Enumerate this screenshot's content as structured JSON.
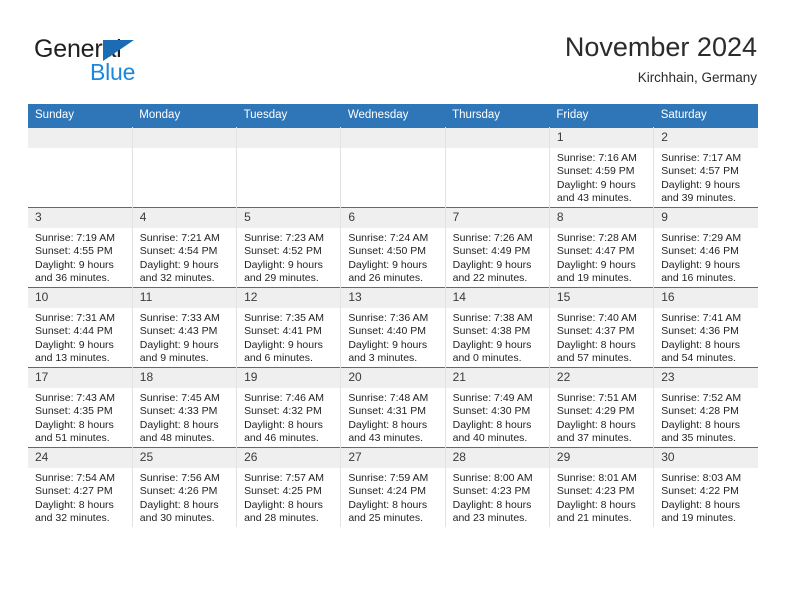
{
  "brand": {
    "name_part1": "General",
    "name_part2": "Blue",
    "triangle_color": "#1b6cb3",
    "blue_text_color": "#1b87dd"
  },
  "header": {
    "title": "November 2024",
    "subtitle": "Kirchhain, Germany"
  },
  "theme": {
    "header_blue": "#2f76b8",
    "daynum_band": "#efefef",
    "cell_border": "#e2e2e2",
    "text": "#231f20"
  },
  "calendar": {
    "weekday_headers": [
      "Sunday",
      "Monday",
      "Tuesday",
      "Wednesday",
      "Thursday",
      "Friday",
      "Saturday"
    ],
    "weeks": [
      [
        {
          "day": "",
          "lines": [
            "",
            "",
            "",
            ""
          ]
        },
        {
          "day": "",
          "lines": [
            "",
            "",
            "",
            ""
          ]
        },
        {
          "day": "",
          "lines": [
            "",
            "",
            "",
            ""
          ]
        },
        {
          "day": "",
          "lines": [
            "",
            "",
            "",
            ""
          ]
        },
        {
          "day": "",
          "lines": [
            "",
            "",
            "",
            ""
          ]
        },
        {
          "day": "1",
          "lines": [
            "Sunrise: 7:16 AM",
            "Sunset: 4:59 PM",
            "Daylight: 9 hours",
            "and 43 minutes."
          ]
        },
        {
          "day": "2",
          "lines": [
            "Sunrise: 7:17 AM",
            "Sunset: 4:57 PM",
            "Daylight: 9 hours",
            "and 39 minutes."
          ]
        }
      ],
      [
        {
          "day": "3",
          "lines": [
            "Sunrise: 7:19 AM",
            "Sunset: 4:55 PM",
            "Daylight: 9 hours",
            "and 36 minutes."
          ]
        },
        {
          "day": "4",
          "lines": [
            "Sunrise: 7:21 AM",
            "Sunset: 4:54 PM",
            "Daylight: 9 hours",
            "and 32 minutes."
          ]
        },
        {
          "day": "5",
          "lines": [
            "Sunrise: 7:23 AM",
            "Sunset: 4:52 PM",
            "Daylight: 9 hours",
            "and 29 minutes."
          ]
        },
        {
          "day": "6",
          "lines": [
            "Sunrise: 7:24 AM",
            "Sunset: 4:50 PM",
            "Daylight: 9 hours",
            "and 26 minutes."
          ]
        },
        {
          "day": "7",
          "lines": [
            "Sunrise: 7:26 AM",
            "Sunset: 4:49 PM",
            "Daylight: 9 hours",
            "and 22 minutes."
          ]
        },
        {
          "day": "8",
          "lines": [
            "Sunrise: 7:28 AM",
            "Sunset: 4:47 PM",
            "Daylight: 9 hours",
            "and 19 minutes."
          ]
        },
        {
          "day": "9",
          "lines": [
            "Sunrise: 7:29 AM",
            "Sunset: 4:46 PM",
            "Daylight: 9 hours",
            "and 16 minutes."
          ]
        }
      ],
      [
        {
          "day": "10",
          "lines": [
            "Sunrise: 7:31 AM",
            "Sunset: 4:44 PM",
            "Daylight: 9 hours",
            "and 13 minutes."
          ]
        },
        {
          "day": "11",
          "lines": [
            "Sunrise: 7:33 AM",
            "Sunset: 4:43 PM",
            "Daylight: 9 hours",
            "and 9 minutes."
          ]
        },
        {
          "day": "12",
          "lines": [
            "Sunrise: 7:35 AM",
            "Sunset: 4:41 PM",
            "Daylight: 9 hours",
            "and 6 minutes."
          ]
        },
        {
          "day": "13",
          "lines": [
            "Sunrise: 7:36 AM",
            "Sunset: 4:40 PM",
            "Daylight: 9 hours",
            "and 3 minutes."
          ]
        },
        {
          "day": "14",
          "lines": [
            "Sunrise: 7:38 AM",
            "Sunset: 4:38 PM",
            "Daylight: 9 hours",
            "and 0 minutes."
          ]
        },
        {
          "day": "15",
          "lines": [
            "Sunrise: 7:40 AM",
            "Sunset: 4:37 PM",
            "Daylight: 8 hours",
            "and 57 minutes."
          ]
        },
        {
          "day": "16",
          "lines": [
            "Sunrise: 7:41 AM",
            "Sunset: 4:36 PM",
            "Daylight: 8 hours",
            "and 54 minutes."
          ]
        }
      ],
      [
        {
          "day": "17",
          "lines": [
            "Sunrise: 7:43 AM",
            "Sunset: 4:35 PM",
            "Daylight: 8 hours",
            "and 51 minutes."
          ]
        },
        {
          "day": "18",
          "lines": [
            "Sunrise: 7:45 AM",
            "Sunset: 4:33 PM",
            "Daylight: 8 hours",
            "and 48 minutes."
          ]
        },
        {
          "day": "19",
          "lines": [
            "Sunrise: 7:46 AM",
            "Sunset: 4:32 PM",
            "Daylight: 8 hours",
            "and 46 minutes."
          ]
        },
        {
          "day": "20",
          "lines": [
            "Sunrise: 7:48 AM",
            "Sunset: 4:31 PM",
            "Daylight: 8 hours",
            "and 43 minutes."
          ]
        },
        {
          "day": "21",
          "lines": [
            "Sunrise: 7:49 AM",
            "Sunset: 4:30 PM",
            "Daylight: 8 hours",
            "and 40 minutes."
          ]
        },
        {
          "day": "22",
          "lines": [
            "Sunrise: 7:51 AM",
            "Sunset: 4:29 PM",
            "Daylight: 8 hours",
            "and 37 minutes."
          ]
        },
        {
          "day": "23",
          "lines": [
            "Sunrise: 7:52 AM",
            "Sunset: 4:28 PM",
            "Daylight: 8 hours",
            "and 35 minutes."
          ]
        }
      ],
      [
        {
          "day": "24",
          "lines": [
            "Sunrise: 7:54 AM",
            "Sunset: 4:27 PM",
            "Daylight: 8 hours",
            "and 32 minutes."
          ]
        },
        {
          "day": "25",
          "lines": [
            "Sunrise: 7:56 AM",
            "Sunset: 4:26 PM",
            "Daylight: 8 hours",
            "and 30 minutes."
          ]
        },
        {
          "day": "26",
          "lines": [
            "Sunrise: 7:57 AM",
            "Sunset: 4:25 PM",
            "Daylight: 8 hours",
            "and 28 minutes."
          ]
        },
        {
          "day": "27",
          "lines": [
            "Sunrise: 7:59 AM",
            "Sunset: 4:24 PM",
            "Daylight: 8 hours",
            "and 25 minutes."
          ]
        },
        {
          "day": "28",
          "lines": [
            "Sunrise: 8:00 AM",
            "Sunset: 4:23 PM",
            "Daylight: 8 hours",
            "and 23 minutes."
          ]
        },
        {
          "day": "29",
          "lines": [
            "Sunrise: 8:01 AM",
            "Sunset: 4:23 PM",
            "Daylight: 8 hours",
            "and 21 minutes."
          ]
        },
        {
          "day": "30",
          "lines": [
            "Sunrise: 8:03 AM",
            "Sunset: 4:22 PM",
            "Daylight: 8 hours",
            "and 19 minutes."
          ]
        }
      ]
    ]
  }
}
